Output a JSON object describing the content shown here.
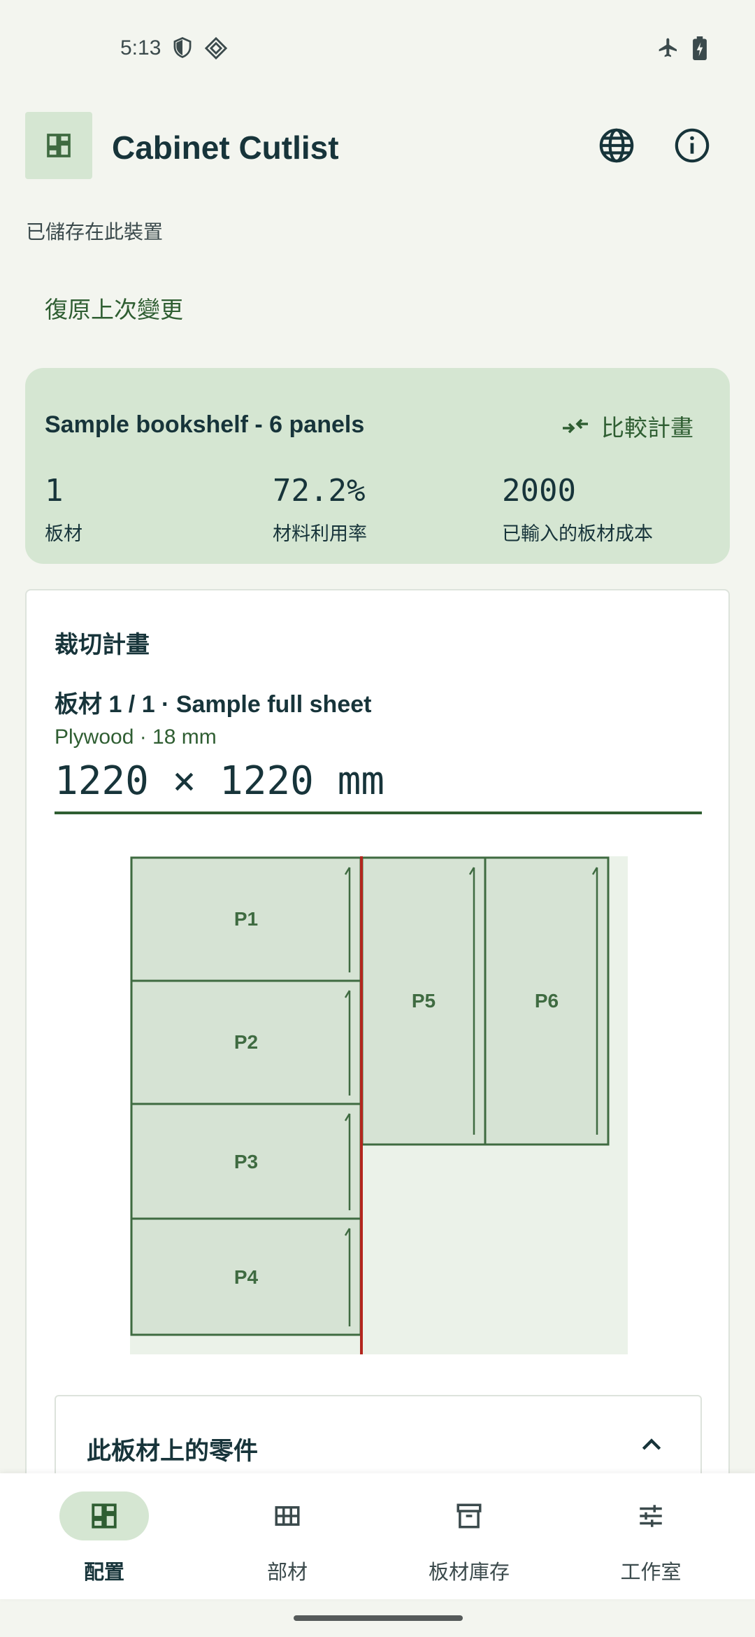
{
  "status_bar": {
    "time": "5:13"
  },
  "app": {
    "title": "Cabinet Cutlist"
  },
  "save_status": "已儲存在此裝置",
  "undo_label": "復原上次變更",
  "summary": {
    "project_name": "Sample bookshelf - 6 panels",
    "compare_label": "比較計畫",
    "stats": [
      {
        "value": "1",
        "label": "板材"
      },
      {
        "value": "72.2%",
        "label": "材料利用率"
      },
      {
        "value": "2000",
        "label": "已輸入的板材成本"
      }
    ]
  },
  "plan": {
    "title": "裁切計畫",
    "sheet_title": "板材 1 / 1 · Sample full sheet",
    "sheet_subtitle": "Plywood · 18 mm",
    "sheet_dims": "1220 × 1220 mm",
    "parts": [
      {
        "id": "P1"
      },
      {
        "id": "P2"
      },
      {
        "id": "P3"
      },
      {
        "id": "P4"
      },
      {
        "id": "P5"
      },
      {
        "id": "P6"
      }
    ],
    "parts_panel_title": "此板材上的零件"
  },
  "bottom_nav": [
    {
      "label": "配置",
      "icon": "dashboard-icon",
      "active": true
    },
    {
      "label": "部材",
      "icon": "grid-icon",
      "active": false
    },
    {
      "label": "板材庫存",
      "icon": "archive-icon",
      "active": false
    },
    {
      "label": "工作室",
      "icon": "tune-icon",
      "active": false
    }
  ],
  "colors": {
    "background": "#f3f5ef",
    "accent_green": "#2f5e32",
    "container_green": "#d5e6d2",
    "text_dark": "#17343a",
    "cut_line_red": "#b3261e"
  }
}
